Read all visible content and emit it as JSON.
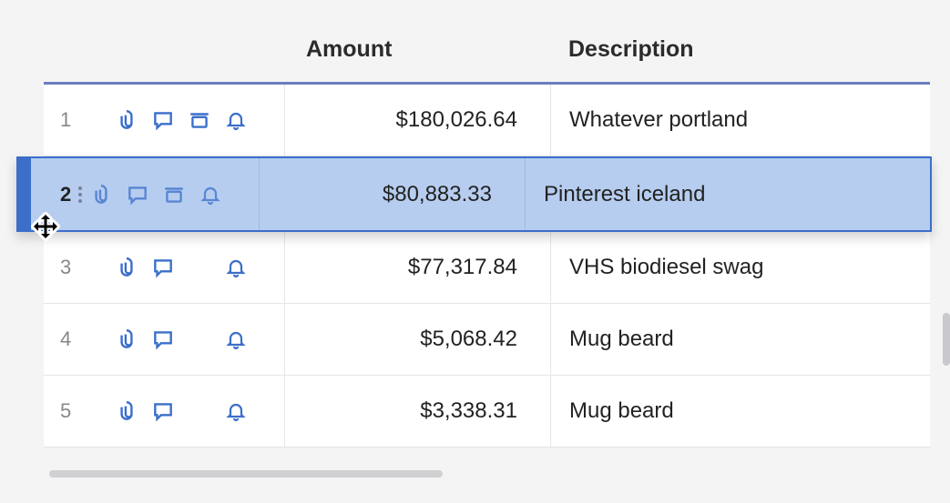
{
  "columns": {
    "amount": "Amount",
    "description": "Description"
  },
  "rows": [
    {
      "num": "1",
      "amount": "$180,026.64",
      "description": "Whatever portland",
      "icons": [
        "attachment",
        "comment",
        "archive",
        "bell"
      ],
      "selected": false
    },
    {
      "num": "2",
      "amount": "$80,883.33",
      "description": "Pinterest iceland",
      "icons": [
        "attachment",
        "comment",
        "archive",
        "bell"
      ],
      "selected": true
    },
    {
      "num": "3",
      "amount": "$77,317.84",
      "description": "VHS biodiesel swag",
      "icons": [
        "attachment",
        "comment",
        "bell"
      ],
      "selected": false
    },
    {
      "num": "4",
      "amount": "$5,068.42",
      "description": "Mug beard",
      "icons": [
        "attachment",
        "comment",
        "bell"
      ],
      "selected": false
    },
    {
      "num": "5",
      "amount": "$3,338.31",
      "description": "Mug beard",
      "icons": [
        "attachment",
        "comment",
        "bell"
      ],
      "selected": false
    }
  ]
}
